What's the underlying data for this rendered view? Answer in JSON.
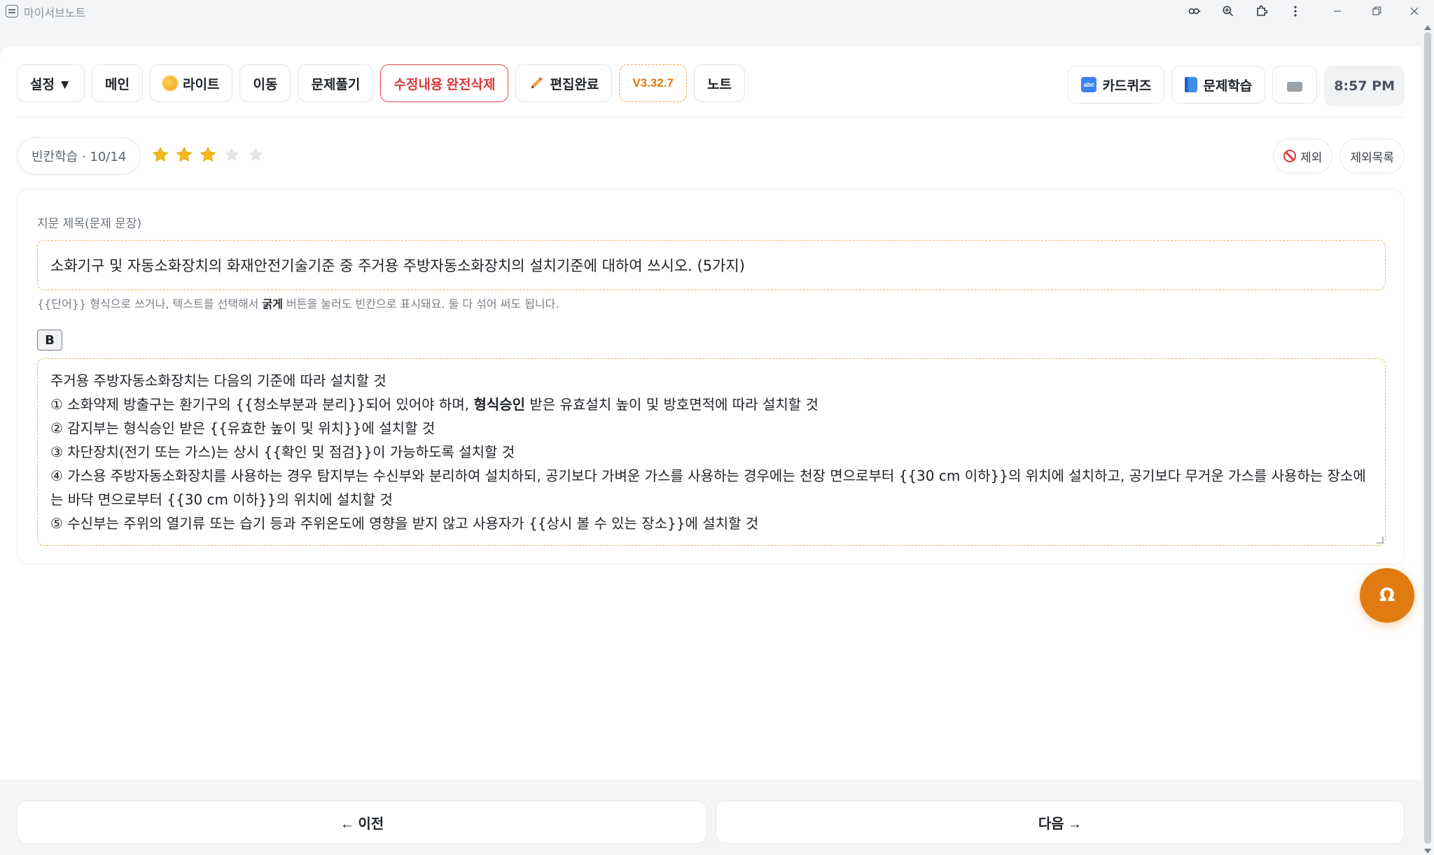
{
  "window": {
    "title": "마이서브노트",
    "controls": [
      "key-icon",
      "zoom-icon",
      "extension-icon",
      "more-icon",
      "minimize-icon",
      "restore-icon",
      "close-icon"
    ]
  },
  "toolbar": {
    "settings_label": "설정 ▼",
    "main_label": "메인",
    "light_label": "라이트",
    "move_label": "이동",
    "solve_label": "문제풀기",
    "delete_label": "수정내용 완전삭제",
    "edit_done_label": "편집완료",
    "version_label": "V3.32.7",
    "note_label": "노트",
    "cardquiz_label": "카드퀴즈",
    "study_label": "문제학습",
    "time": "8:57 PM"
  },
  "status": {
    "mode_label": "빈칸학습 · 10/14",
    "rating": 3,
    "rating_max": 5,
    "exclude_label": "제외",
    "exclude_list_label": "제외목록"
  },
  "editor": {
    "title_label": "지문 제목(문제 문장)",
    "title_value": "소화기구 및 자동소화장치의 화재안전기술기준 중 주거용 주방자동소화장치의 설치기준에 대하여 쓰시오. (5가지)",
    "hint_pre": "{{단어}} 형식으로 쓰거나, 텍스트를 선택해서 ",
    "hint_bold": "굵게",
    "hint_post": " 버튼을 눌러도 빈칸으로 표시돼요. 둘 다 섞어 써도 됩니다.",
    "bold_button": "B",
    "body": {
      "line0": "주거용 주방자동소화장치는 다음의 기준에 따라 설치할 것",
      "line1_pre": "① 소화약제 방출구는 환기구의 {{청소부분과 분리}}되어 있어야 하며, ",
      "line1_bold": "형식승인",
      "line1_post": " 받은 유효설치 높이 및 방호면적에 따라 설치할 것",
      "line2": "② 감지부는 형식승인 받은 {{유효한 높이 및 위치}}에 설치할 것",
      "line3": "③ 차단장치(전기 또는 가스)는 상시 {{확인 및 점검}}이 가능하도록 설치할 것",
      "line4": "④ 가스용 주방자동소화장치를 사용하는 경우 탐지부는 수신부와 분리하여 설치하되, 공기보다 가벼운 가스를 사용하는 경우에는 천장 면으로부터 {{30 cm 이하}}의 위치에 설치하고, 공기보다 무거운 가스를 사용하는 장소에는 바닥 면으로부터 {{30 cm 이하}}의 위치에 설치할 것",
      "line5": "⑤ 수신부는 주위의 열기류 또는 습기 등과 주위온도에 영향을 받지 않고 사용자가 {{상시 볼 수 있는 장소}}에 설치할 것"
    }
  },
  "fab": {
    "label": "Ω"
  },
  "nav": {
    "prev_label": "← 이전",
    "next_label": "다음 →"
  },
  "colors": {
    "accent": "#e07b12",
    "danger": "#d63a3a",
    "star": "#f5b919",
    "star_empty": "#e3e5e8"
  }
}
